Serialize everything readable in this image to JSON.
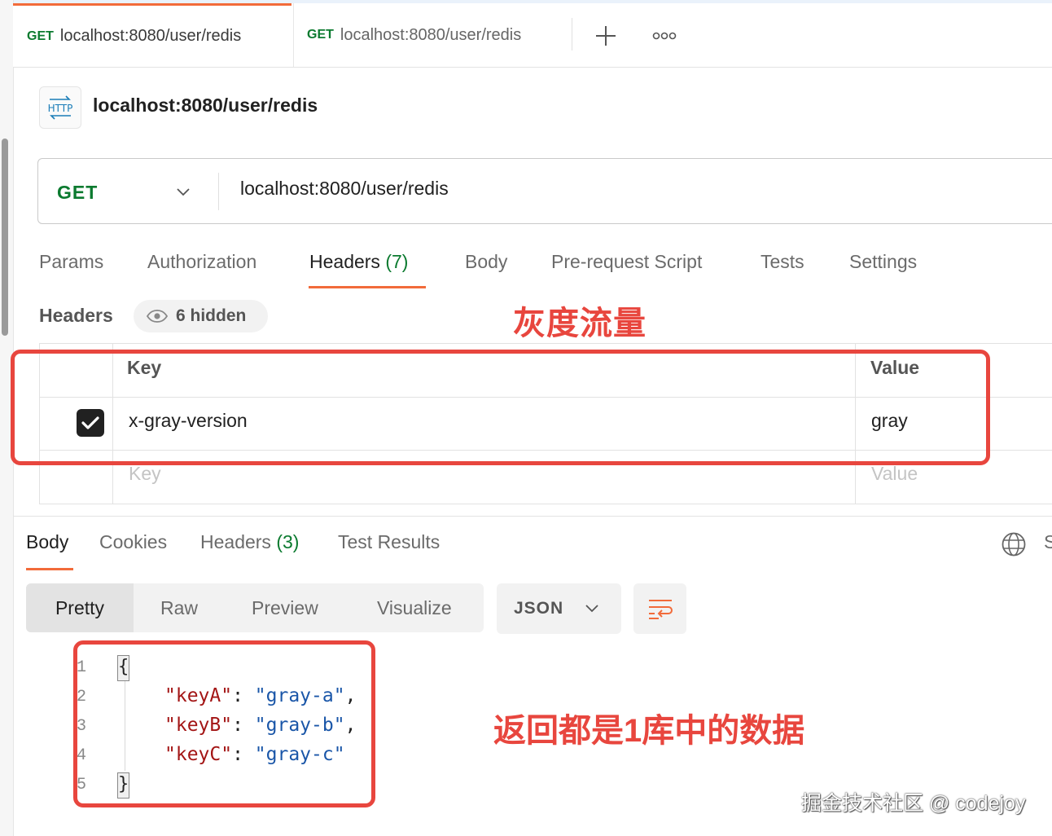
{
  "tabs": [
    {
      "method": "GET",
      "url": "localhost:8080/user/redis"
    },
    {
      "method": "GET",
      "url": "localhost:8080/user/redis"
    }
  ],
  "tab_actions": {
    "new_tab": "new-tab-plus-icon",
    "more": "more-tabs-icon"
  },
  "request": {
    "icon": "http-icon",
    "icon_text": "HTTP",
    "title": "localhost:8080/user/redis",
    "method": "GET",
    "url": "localhost:8080/user/redis"
  },
  "request_tabs": [
    {
      "label": "Params"
    },
    {
      "label": "Authorization"
    },
    {
      "label": "Headers",
      "count": "(7)",
      "active": true
    },
    {
      "label": "Body"
    },
    {
      "label": "Pre-request Script"
    },
    {
      "label": "Tests"
    },
    {
      "label": "Settings"
    }
  ],
  "headers_section": {
    "title": "Headers",
    "hidden_label": "6 hidden",
    "columns": {
      "key": "Key",
      "value": "Value"
    },
    "rows": [
      {
        "checked": true,
        "key": "x-gray-version",
        "value": "gray"
      }
    ],
    "new_row": {
      "key_placeholder": "Key",
      "value_placeholder": "Value"
    }
  },
  "annotations": {
    "gray_traffic": "灰度流量",
    "body_note": "返回都是1库中的数据"
  },
  "response": {
    "tabs": [
      {
        "label": "Body",
        "active": true
      },
      {
        "label": "Cookies"
      },
      {
        "label": "Headers",
        "count": "(3)"
      },
      {
        "label": "Test Results"
      }
    ],
    "cut_label": "S",
    "view_modes": [
      "Pretty",
      "Raw",
      "Preview",
      "Visualize"
    ],
    "active_view": "Pretty",
    "format": "JSON",
    "line_numbers": [
      "1",
      "2",
      "3",
      "4",
      "5"
    ],
    "body_lines": [
      {
        "brace": "{"
      },
      {
        "key": "\"keyA\"",
        "value": "\"gray-a\"",
        "trail": ","
      },
      {
        "key": "\"keyB\"",
        "value": "\"gray-b\"",
        "trail": ","
      },
      {
        "key": "\"keyC\"",
        "value": "\"gray-c\"",
        "trail": ""
      },
      {
        "brace": "}"
      }
    ]
  },
  "colors": {
    "accent": "#f26b3a",
    "method_green": "#0b7a2f",
    "annotation_red": "#e8463e"
  },
  "watermark": "掘金技术社区 @ codejoy"
}
